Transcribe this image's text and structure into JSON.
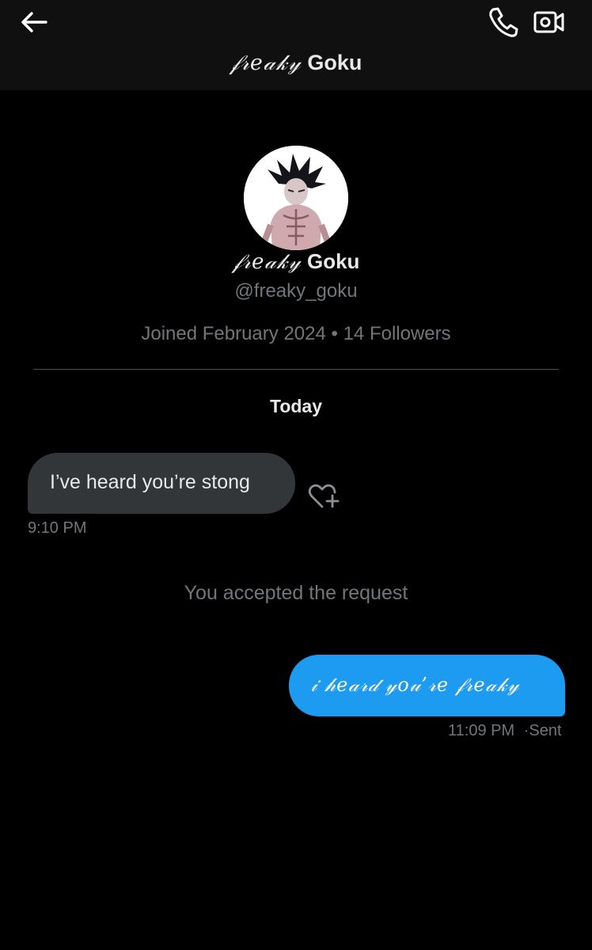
{
  "header": {
    "title_fancy": "𝒻𝓇𝑒𝒶𝓀𝓎",
    "title_name": "Goku",
    "icons": {
      "back": "arrow-left-icon",
      "call": "phone-icon",
      "video": "video-camera-icon"
    }
  },
  "profile": {
    "name_fancy": "𝒻𝓇𝑒𝒶𝓀𝓎",
    "name": "Goku",
    "handle": "@freaky_goku",
    "joined": "Joined February 2024",
    "separator": "•",
    "followers": "14 Followers"
  },
  "conversation": {
    "date_label": "Today",
    "incoming": {
      "text": "I’ve heard you’re stong",
      "time": "9:10 PM"
    },
    "system": "You accepted the request",
    "outgoing": {
      "text": "𝒾 𝒽𝑒𝒶𝓇𝒹 𝓎𝑜𝓊’𝓇𝑒 𝒻𝓇𝑒𝒶𝓀𝓎",
      "time": "11:09 PM",
      "status": "Sent"
    }
  },
  "colors": {
    "background": "#000000",
    "header": "#101010",
    "accent": "#1d9bf0",
    "incoming_bubble": "#333639",
    "muted": "#71767b"
  }
}
